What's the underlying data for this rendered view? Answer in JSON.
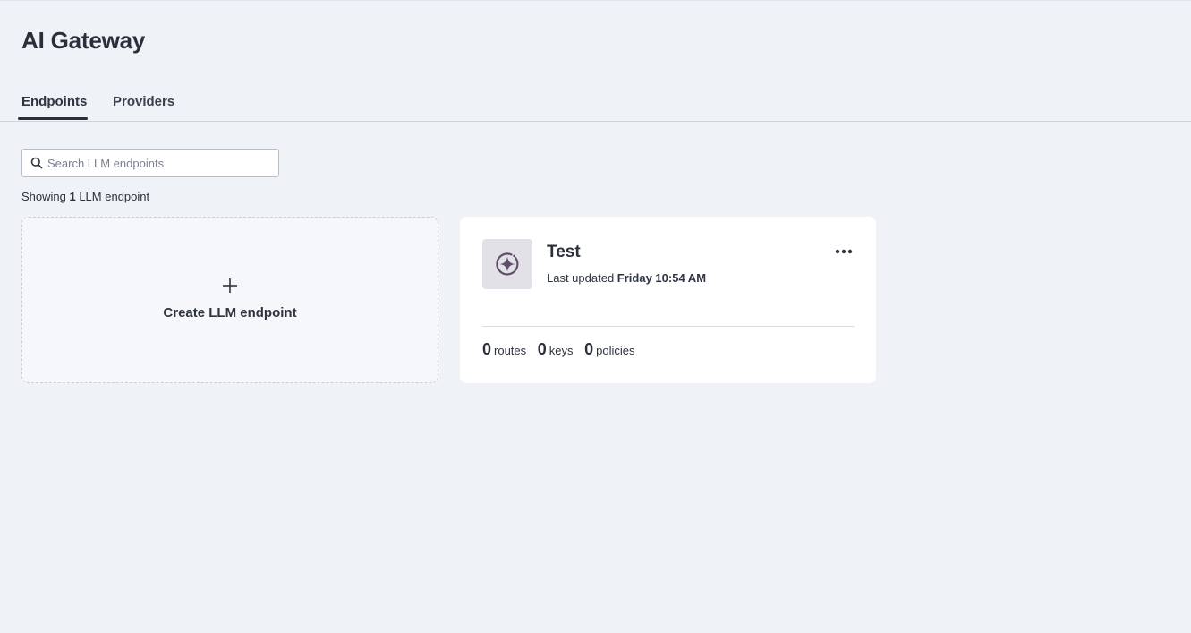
{
  "header": {
    "title": "AI Gateway"
  },
  "tabs": [
    {
      "label": "Endpoints",
      "active": true
    },
    {
      "label": "Providers",
      "active": false
    }
  ],
  "search": {
    "placeholder": "Search LLM endpoints",
    "value": "",
    "icon": "search-icon"
  },
  "results": {
    "prefix": "Showing ",
    "count": "1",
    "suffix": " LLM endpoint"
  },
  "create_card": {
    "icon": "plus-icon",
    "label": "Create LLM endpoint"
  },
  "endpoints": [
    {
      "name": "Test",
      "icon": "ai-sparkle-icon",
      "updated_prefix": "Last updated ",
      "updated_time": "Friday 10:54 AM",
      "menu_icon": "more-horizontal-icon",
      "stats": [
        {
          "count": "0",
          "label": "routes"
        },
        {
          "count": "0",
          "label": "keys"
        },
        {
          "count": "0",
          "label": "policies"
        }
      ]
    }
  ],
  "colors": {
    "background": "#eff2f7",
    "card": "#ffffff",
    "text": "#2a2f3a",
    "icon_tile": "#e3e1e8",
    "icon_stroke": "#5d5068"
  }
}
